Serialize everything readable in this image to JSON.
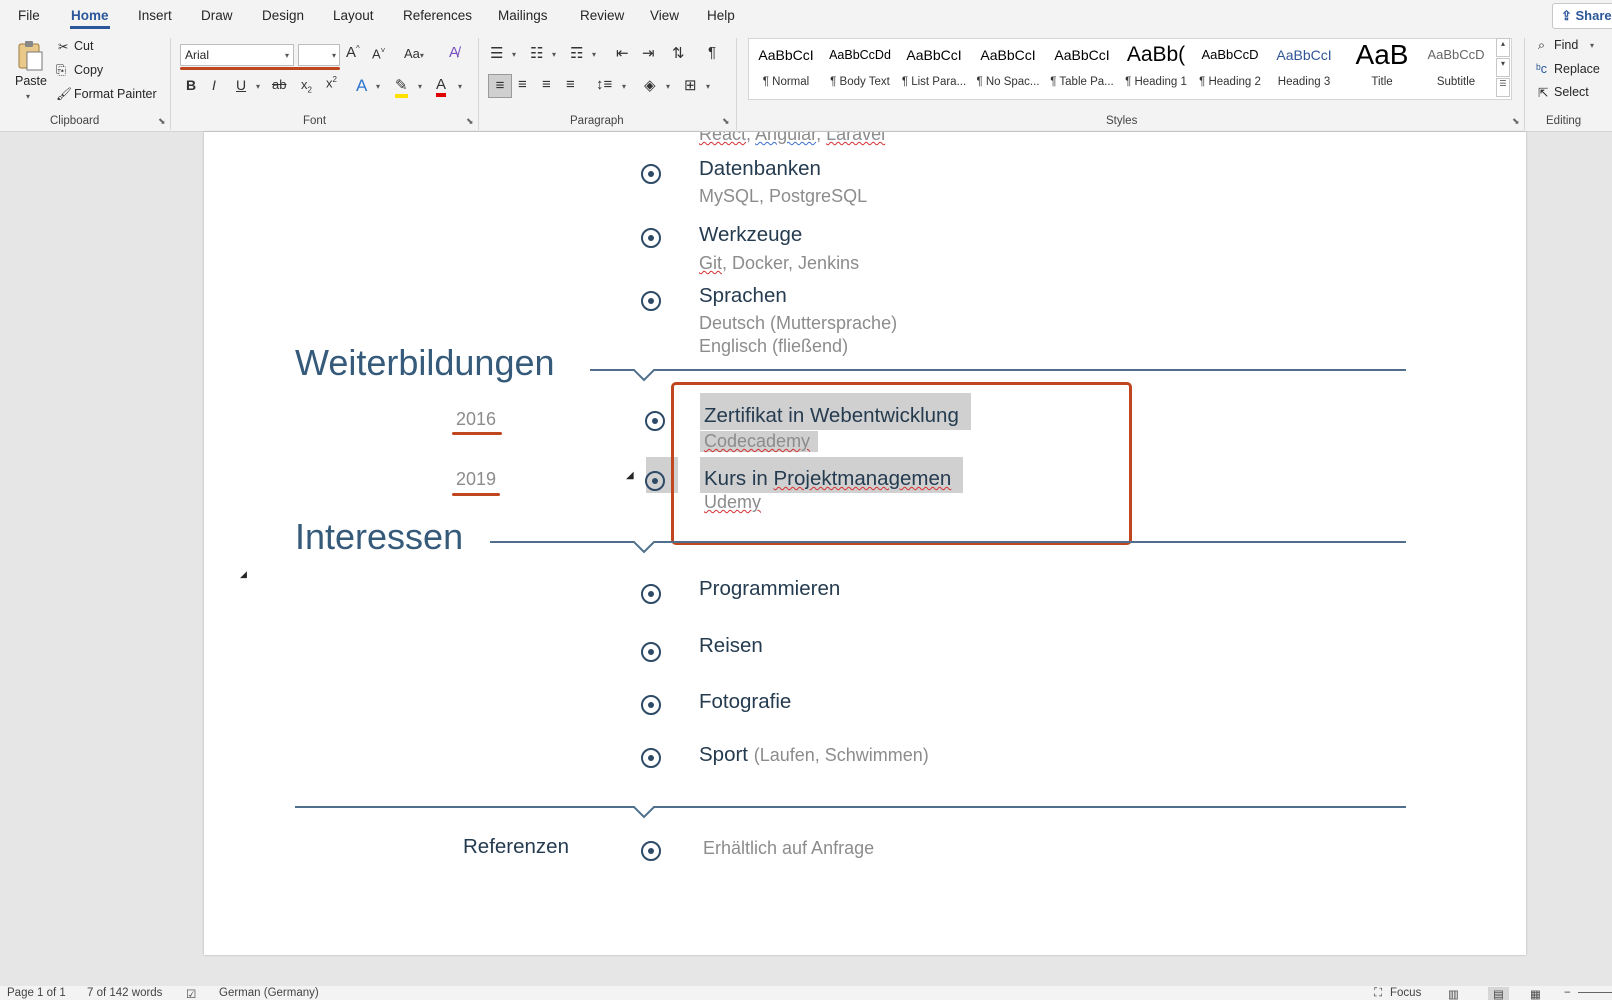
{
  "menu": {
    "items": [
      "File",
      "Home",
      "Insert",
      "Draw",
      "Design",
      "Layout",
      "References",
      "Mailings",
      "Review",
      "View",
      "Help"
    ],
    "share": "Share"
  },
  "ribbon": {
    "clipboard": {
      "paste": "Paste",
      "cut": "Cut",
      "copy": "Copy",
      "format_painter": "Format Painter",
      "label": "Clipboard"
    },
    "font": {
      "font_name": "Arial",
      "font_size": "",
      "label": "Font"
    },
    "paragraph": {
      "label": "Paragraph"
    },
    "styles": {
      "label": "Styles",
      "items": [
        {
          "preview": "AaBbCcI",
          "name": "¶ Normal"
        },
        {
          "preview": "AaBbCcDd",
          "name": "¶ Body Text"
        },
        {
          "preview": "AaBbCcI",
          "name": "¶ List Para..."
        },
        {
          "preview": "AaBbCcI",
          "name": "¶ No Spac..."
        },
        {
          "preview": "AaBbCcI",
          "name": "¶ Table Pa..."
        },
        {
          "preview": "AaBb(",
          "name": "¶ Heading 1"
        },
        {
          "preview": "AaBbCcD",
          "name": "¶ Heading 2"
        },
        {
          "preview": "AaBbCcI",
          "name": "Heading 3"
        },
        {
          "preview": "AaB",
          "name": "Title"
        },
        {
          "preview": "AaBbCcD",
          "name": "Subtitle"
        }
      ]
    },
    "editing": {
      "find": "Find",
      "replace": "Replace",
      "select": "Select",
      "label": "Editing"
    }
  },
  "document": {
    "top_partial": {
      "a": "React",
      "b": "Angular",
      "c": "Laravel"
    },
    "skills": [
      {
        "title": "Datenbanken",
        "sub1": "MySQL,",
        "sub2": "PostgreSQL"
      },
      {
        "title": "Werkzeuge",
        "sub1": "Git",
        "sub2": ", Docker, Jenkins"
      },
      {
        "title": "Sprachen",
        "sub1": "Deutsch (Muttersprache)",
        "sub2": "Englisch (fließend)"
      }
    ],
    "weiterbildungen": {
      "heading": "Weiterbildungen",
      "entries": [
        {
          "year": "2016",
          "title": "Zertifikat  in Webentwicklung",
          "provider": "Codecademy"
        },
        {
          "year": "2019",
          "title_a": "Kurs in ",
          "title_b": "Projektmanagemen",
          "provider": "Udemy"
        }
      ]
    },
    "interessen": {
      "heading": "Interessen",
      "items": [
        "Programmieren",
        "Reisen",
        "Fotografie",
        "Sport"
      ],
      "sport_detail": "(Laufen,  Schwimmen)"
    },
    "referenzen": {
      "label": "Referenzen",
      "value": "Erhältlich  auf  Anfrage"
    }
  },
  "status": {
    "page": "Page 1 of 1",
    "words": "7 of 142 words",
    "language": "German (Germany)",
    "focus": "Focus"
  }
}
